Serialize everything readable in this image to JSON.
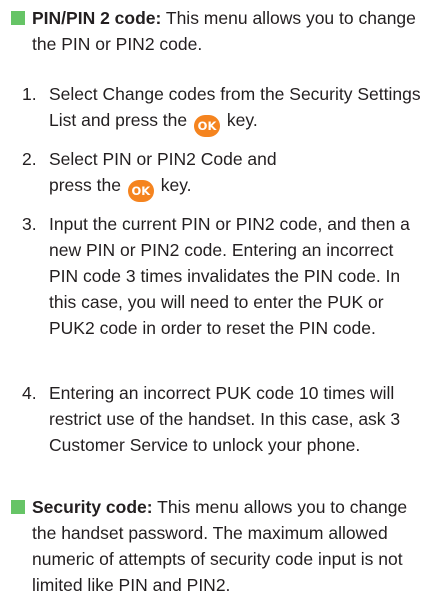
{
  "colors": {
    "bullet": "#66c466",
    "ok_key": "#f5841f",
    "text": "#231f20"
  },
  "pin_section": {
    "title": "PIN/PIN 2 code:",
    "description": " This menu allows you to change the PIN or PIN2 code.",
    "steps": [
      {
        "number": "1.",
        "text_before": "Select Change codes from the Security Settings List and press the",
        "text_after": "key."
      },
      {
        "number": "2.",
        "text_before": "Select PIN or PIN2 Code and press the",
        "text_after": "key."
      },
      {
        "number": "3.",
        "text": "Input the current PIN or PIN2 code, and then a new PIN or PIN2 code. Entering an incorrect PIN code 3 times invalidates the PIN code. In this case, you will need to enter the PUK or PUK2 code in order to reset the PIN code."
      },
      {
        "number": "4.",
        "text": "Entering an incorrect PUK code 10 times will restrict use of the handset. In this case, ask 3 Customer Service to unlock your phone."
      }
    ]
  },
  "security_section": {
    "title": "Security code:",
    "description": " This menu allows you to change the handset password. The maximum allowed numeric of attempts of security code input is not limited like PIN and PIN2."
  },
  "ok_key_label": "OK",
  "icons": {
    "ok_key": "ok-key-icon",
    "bullet": "bullet-square-icon"
  }
}
